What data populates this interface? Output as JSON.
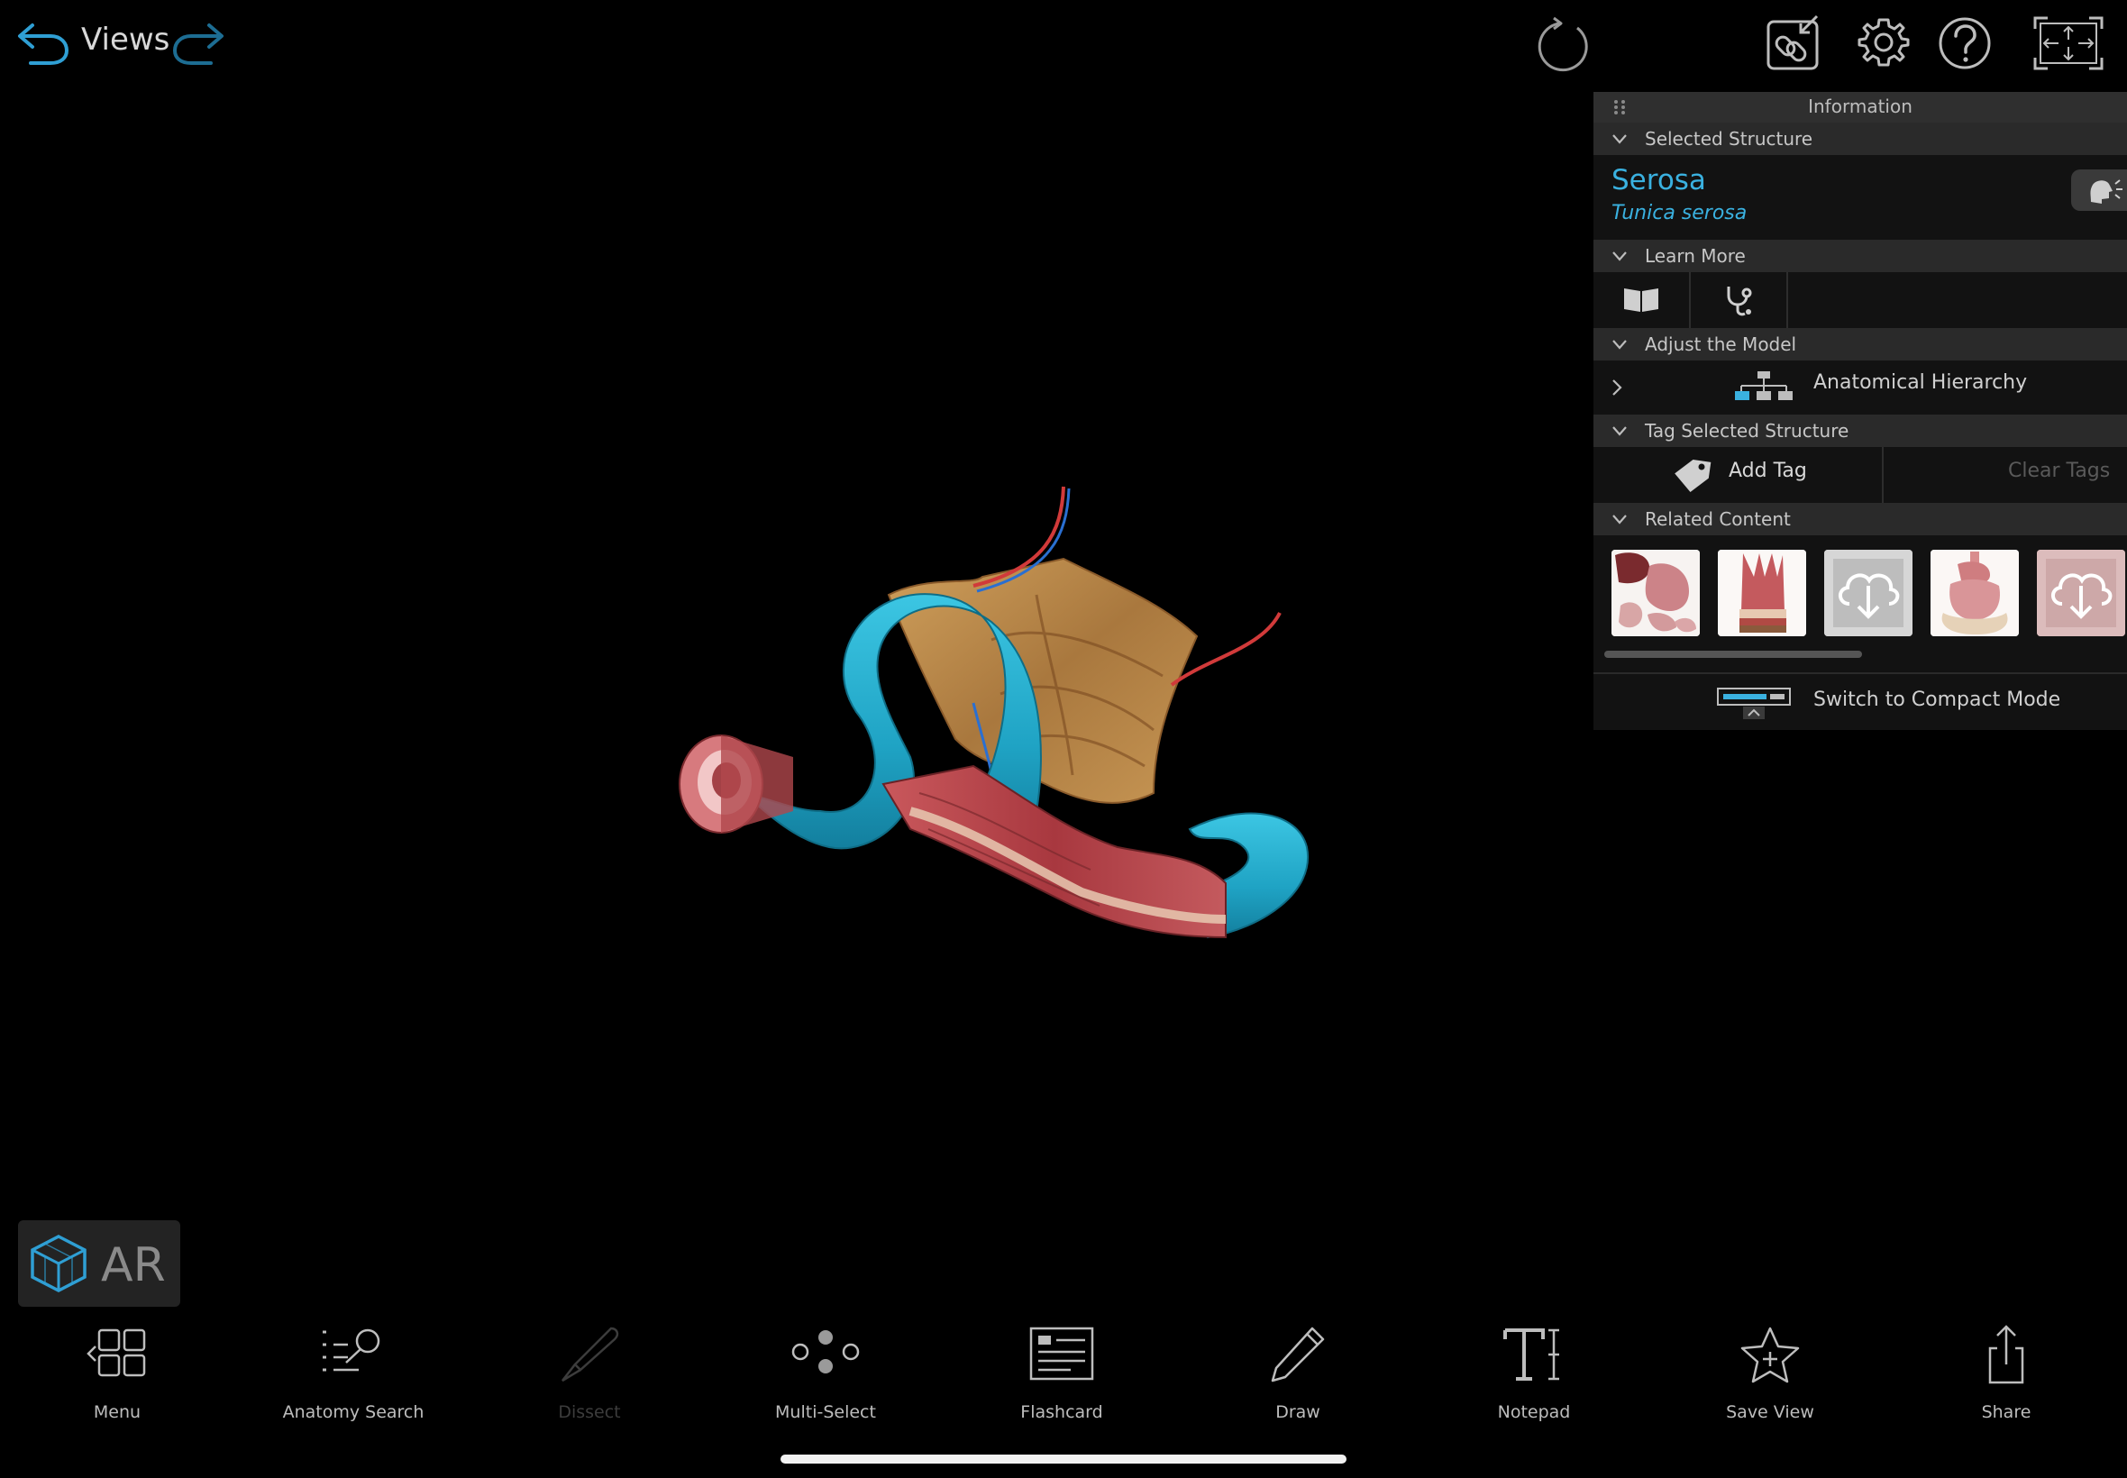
{
  "topbar": {
    "views_label": "Views"
  },
  "info_panel": {
    "title": "Information",
    "selected_structure": {
      "header": "Selected Structure",
      "name": "Serosa",
      "latin_name": "Tunica serosa"
    },
    "learn_more": {
      "header": "Learn More",
      "icons": [
        "book-icon",
        "stethoscope-icon"
      ]
    },
    "adjust_model": {
      "header": "Adjust the Model",
      "hierarchy_label": "Anatomical Hierarchy"
    },
    "tag_structure": {
      "header": "Tag Selected Structure",
      "add_tag": "Add Tag",
      "clear_tags": "Clear Tags"
    },
    "related_content": {
      "header": "Related Content"
    },
    "compact_mode_label": "Switch to Compact Mode"
  },
  "ar": {
    "label": "AR"
  },
  "toolbar": {
    "menu": "Menu",
    "anatomy_search": "Anatomy Search",
    "dissect": "Dissect",
    "multi_select": "Multi-Select",
    "flashcard": "Flashcard",
    "draw": "Draw",
    "notepad": "Notepad",
    "save_view": "Save View",
    "share": "Share"
  },
  "colors": {
    "accent": "#3ab1e0",
    "structure_blue": "#1fa3c4",
    "tissue_red": "#b8474c",
    "mesentery_tan": "#b8894a"
  }
}
